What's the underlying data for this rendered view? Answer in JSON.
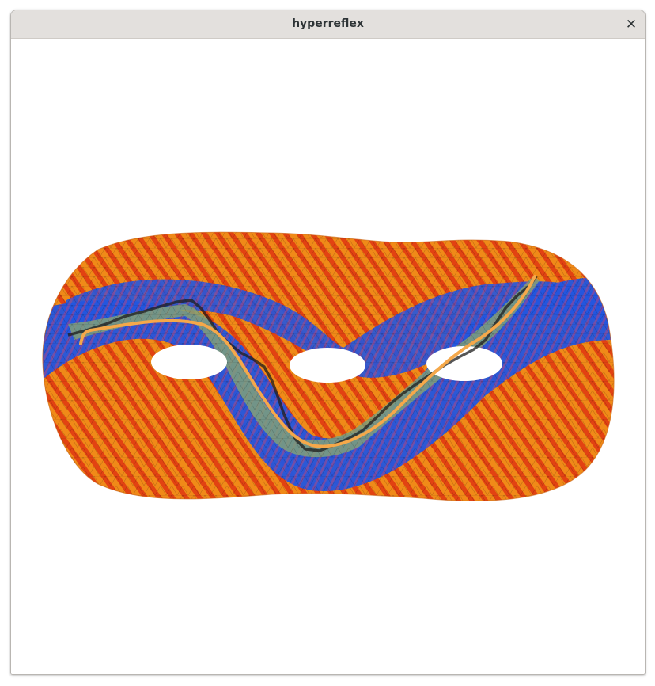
{
  "window": {
    "title": "hyperreflex",
    "close_glyph": "✕"
  },
  "viewport": {
    "background": "#ffffff",
    "model": "genus-3 surface",
    "colors": {
      "warm_edge": "#f7a01a",
      "warm_mid": "#e84a14",
      "hot": "#d82a10",
      "purple": "#7a4aa8",
      "cool": "#2256e0",
      "band_green": "#7fa07a",
      "path_highlight": "#f5a84a",
      "mesh_line": "#000000"
    },
    "icons": [
      "close-icon"
    ]
  }
}
